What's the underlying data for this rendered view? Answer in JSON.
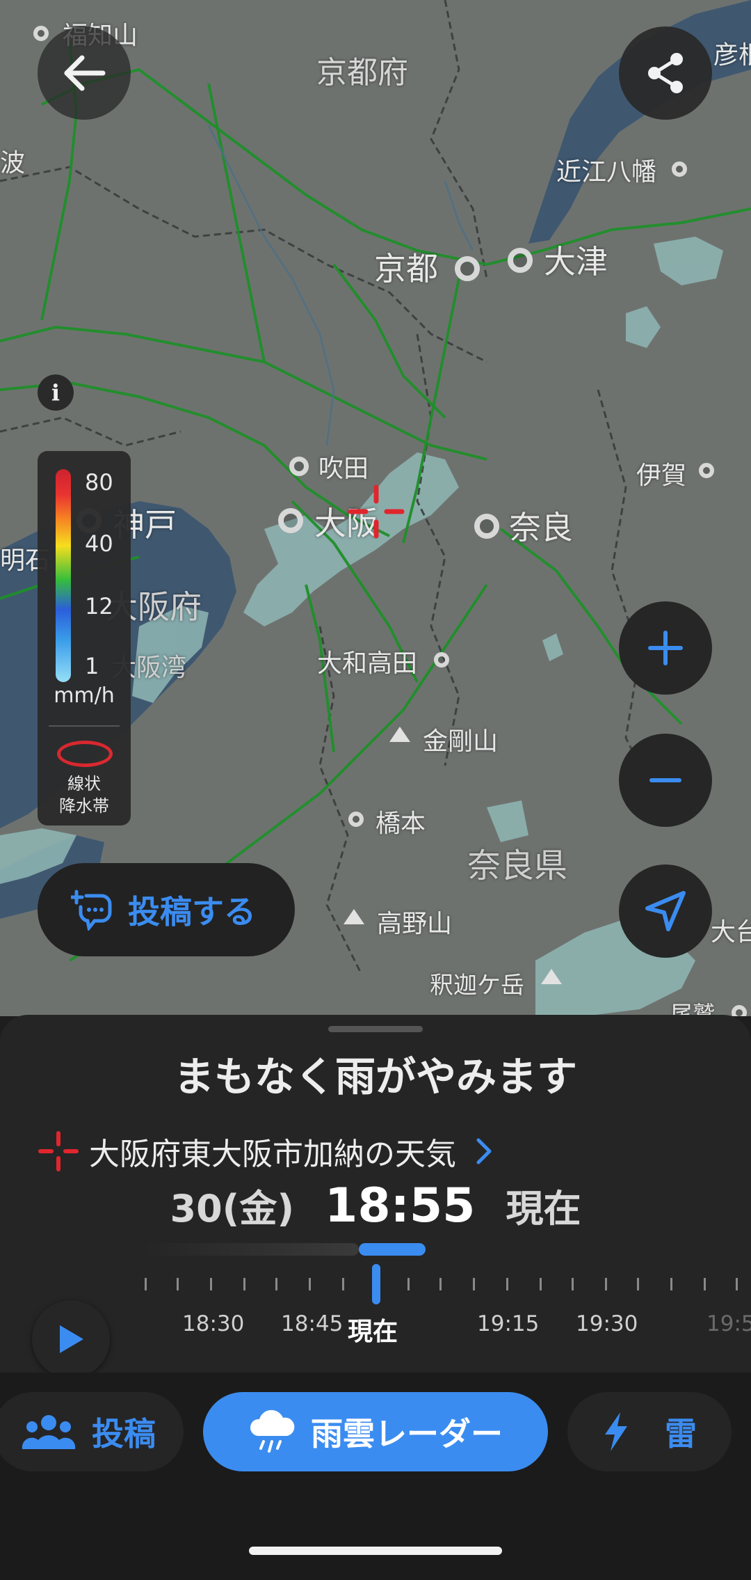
{
  "map": {
    "places": [
      {
        "id": "fukuchiyama",
        "label": "福知山"
      },
      {
        "id": "kyotofu",
        "label": "京都府"
      },
      {
        "id": "hikone",
        "label": "彦根"
      },
      {
        "id": "omihachiman",
        "label": "近江八幡"
      },
      {
        "id": "kyoto",
        "label": "京都"
      },
      {
        "id": "otsu",
        "label": "大津"
      },
      {
        "id": "suita",
        "label": "吹田"
      },
      {
        "id": "iga",
        "label": "伊賀"
      },
      {
        "id": "kobe",
        "label": "神戸"
      },
      {
        "id": "akashi",
        "label": "明石"
      },
      {
        "id": "osaka",
        "label": "大阪"
      },
      {
        "id": "nara",
        "label": "奈良"
      },
      {
        "id": "osakafu",
        "label": "大阪府"
      },
      {
        "id": "osakawan",
        "label": "大阪湾"
      },
      {
        "id": "yamatotakada",
        "label": "大和高田"
      },
      {
        "id": "kongosan",
        "label": "金剛山"
      },
      {
        "id": "hashimoto",
        "label": "橋本"
      },
      {
        "id": "naraken",
        "label": "奈良県"
      },
      {
        "id": "koyasan",
        "label": "高野山"
      },
      {
        "id": "ohdai",
        "label": "大台"
      },
      {
        "id": "shakagatake",
        "label": "釈迦ケ岳"
      },
      {
        "id": "owase",
        "label": "尾鷲"
      },
      {
        "id": "ha",
        "label": "波"
      }
    ]
  },
  "legend": {
    "values": [
      "80",
      "40",
      "12",
      "1"
    ],
    "unit": "mm/h",
    "band_label_line1": "線状",
    "band_label_line2": "降水帯"
  },
  "post_button_label": "投稿する",
  "sheet": {
    "headline": "まもなく雨がやみます",
    "location": "大阪府東大阪市加納の天気",
    "date": "30(金)",
    "time": "18:55",
    "now_label": "現在",
    "timeline_labels": [
      "18:30",
      "18:45",
      "現在",
      "19:15",
      "19:30",
      "19:5"
    ]
  },
  "tabs": {
    "post": "投稿",
    "radar": "雨雲レーダー",
    "thunder": "雷"
  },
  "colors": {
    "accent": "#3b8cf0",
    "sheet_bg": "#252526",
    "map_land": "#6f7370",
    "map_water": "#3f5870",
    "rail": "#1f8f2a",
    "rain_light": "#8fb7b5"
  },
  "icons": [
    "back-arrow-icon",
    "share-icon",
    "info-icon",
    "crosshair-icon",
    "zoom-in-icon",
    "zoom-out-icon",
    "location-arrow-icon",
    "post-chat-icon",
    "play-icon",
    "chevron-right-icon",
    "people-icon",
    "rain-cloud-icon",
    "lightning-icon"
  ]
}
